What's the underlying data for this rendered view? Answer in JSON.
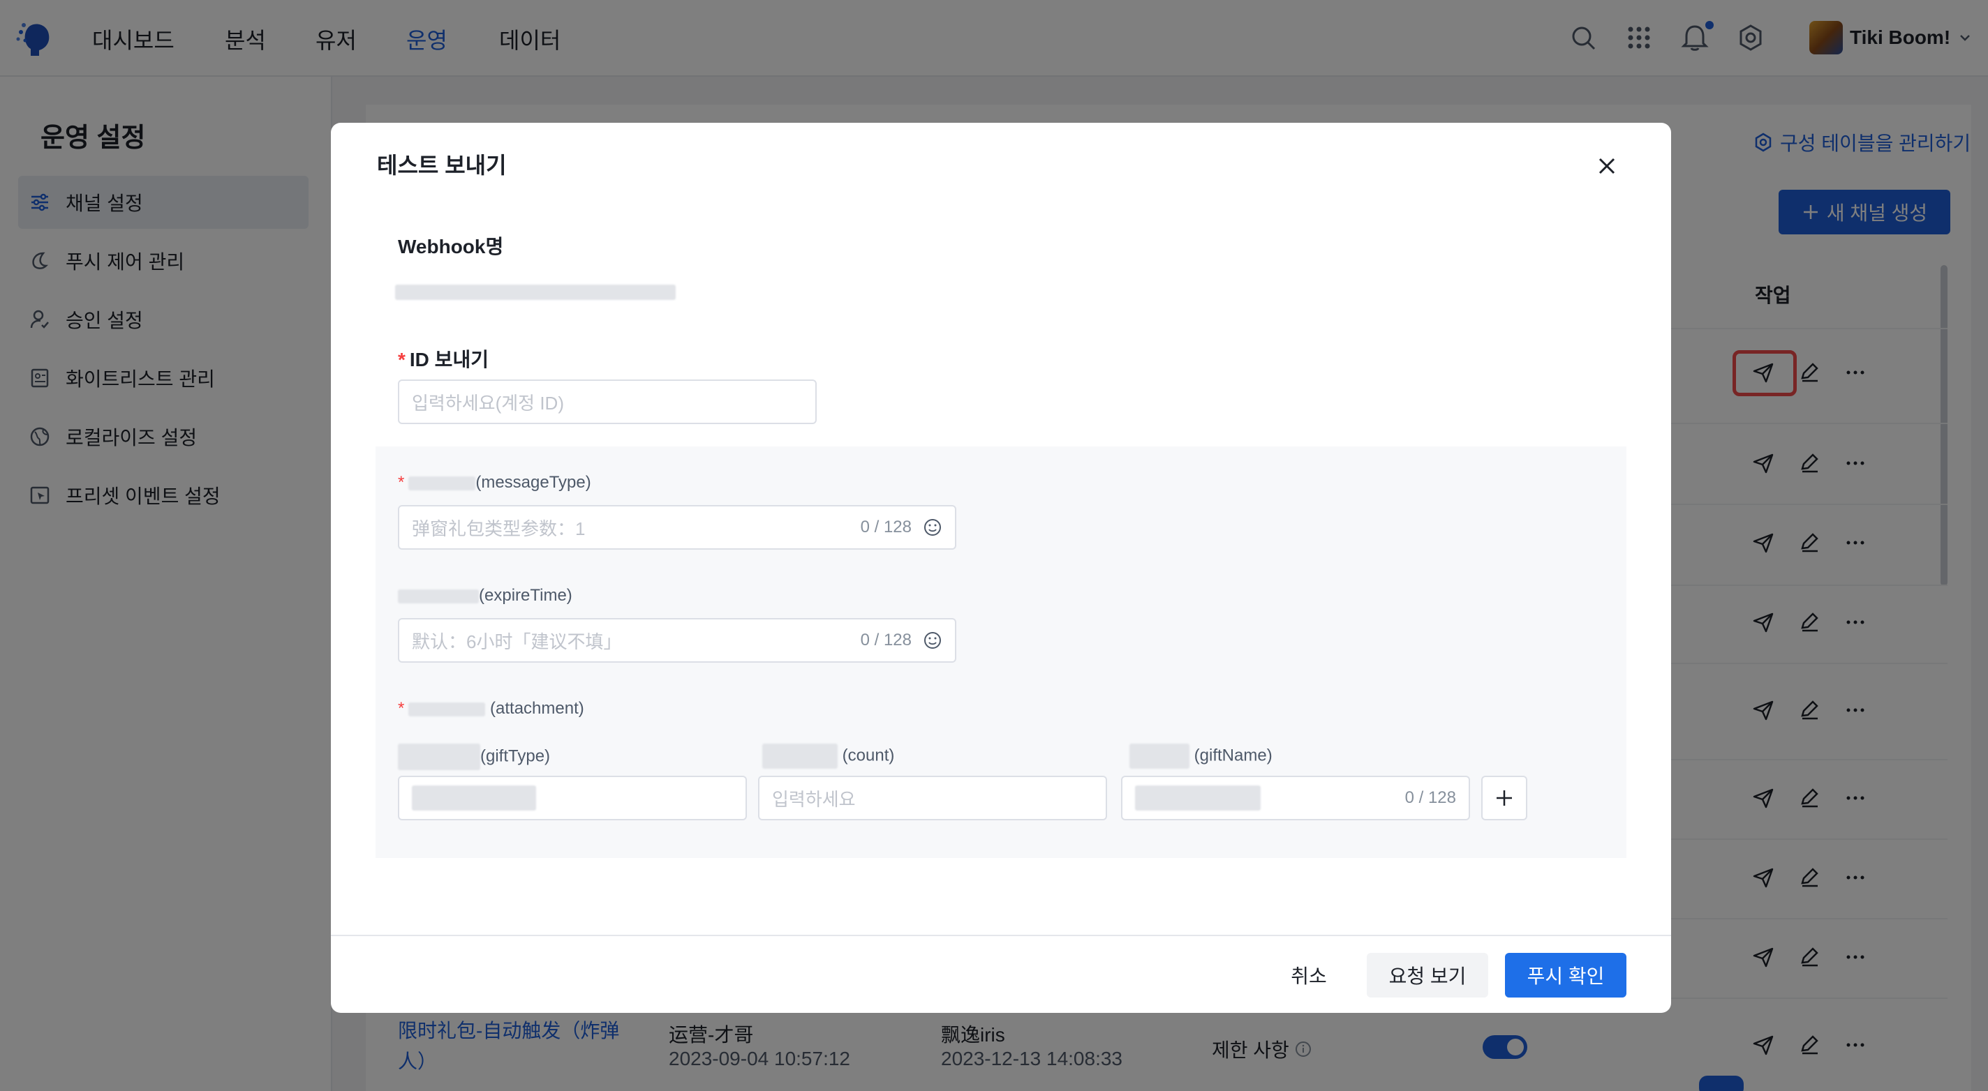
{
  "nav": {
    "items": [
      "대시보드",
      "분석",
      "유저",
      "운영",
      "데이터"
    ],
    "active_index": 3,
    "user_name": "Tiki Boom!"
  },
  "sidebar": {
    "title": "운영 설정",
    "items": [
      {
        "label": "채널 설정",
        "icon": "sliders-icon"
      },
      {
        "label": "푸시 제어 관리",
        "icon": "moon-icon"
      },
      {
        "label": "승인 설정",
        "icon": "user-check-icon"
      },
      {
        "label": "화이트리스트 관리",
        "icon": "contact-card-icon"
      },
      {
        "label": "로컬라이즈 설정",
        "icon": "globe-icon"
      },
      {
        "label": "프리셋 이벤트 설정",
        "icon": "event-cursor-icon"
      }
    ]
  },
  "main": {
    "manage_link": "구성 테이블을 관리하기",
    "new_channel_button": "새 채널 생성",
    "actions_column": "작업",
    "last_row": {
      "name": "限时礼包-自动触发（炸弹",
      "name_line2": "人）",
      "creator": "运营-才哥",
      "created_at": "2023-09-04 10:57:12",
      "updater": "飘逸iris",
      "updated_at": "2023-12-13 14:08:33",
      "restriction": "제한 사항"
    }
  },
  "modal": {
    "title": "테스트 보내기",
    "webhook_label": "Webhook명",
    "sender_id_label": "ID 보내기",
    "sender_id_placeholder": "입력하세요(계정 ID)",
    "message_type_suffix": "(messageType)",
    "message_type_placeholder": "弹窗礼包类型参数：1",
    "message_type_count": "0 / 128",
    "expire_time_suffix": "(expireTime)",
    "expire_time_placeholder": "默认：6小时「建议不填」",
    "expire_time_count": "0 / 128",
    "attachment_suffix": "(attachment)",
    "gift_type_suffix": "(giftType)",
    "count_suffix": "(count)",
    "count_placeholder": "입력하세요",
    "gift_name_suffix": "(giftName)",
    "gift_name_count": "0 / 128",
    "cancel_button": "취소",
    "view_request_button": "요청 보기",
    "confirm_push_button": "푸시 확인"
  },
  "colors": {
    "primary": "#1e5fd8",
    "highlight_border": "#f04b4b",
    "required": "#f53f3f"
  }
}
